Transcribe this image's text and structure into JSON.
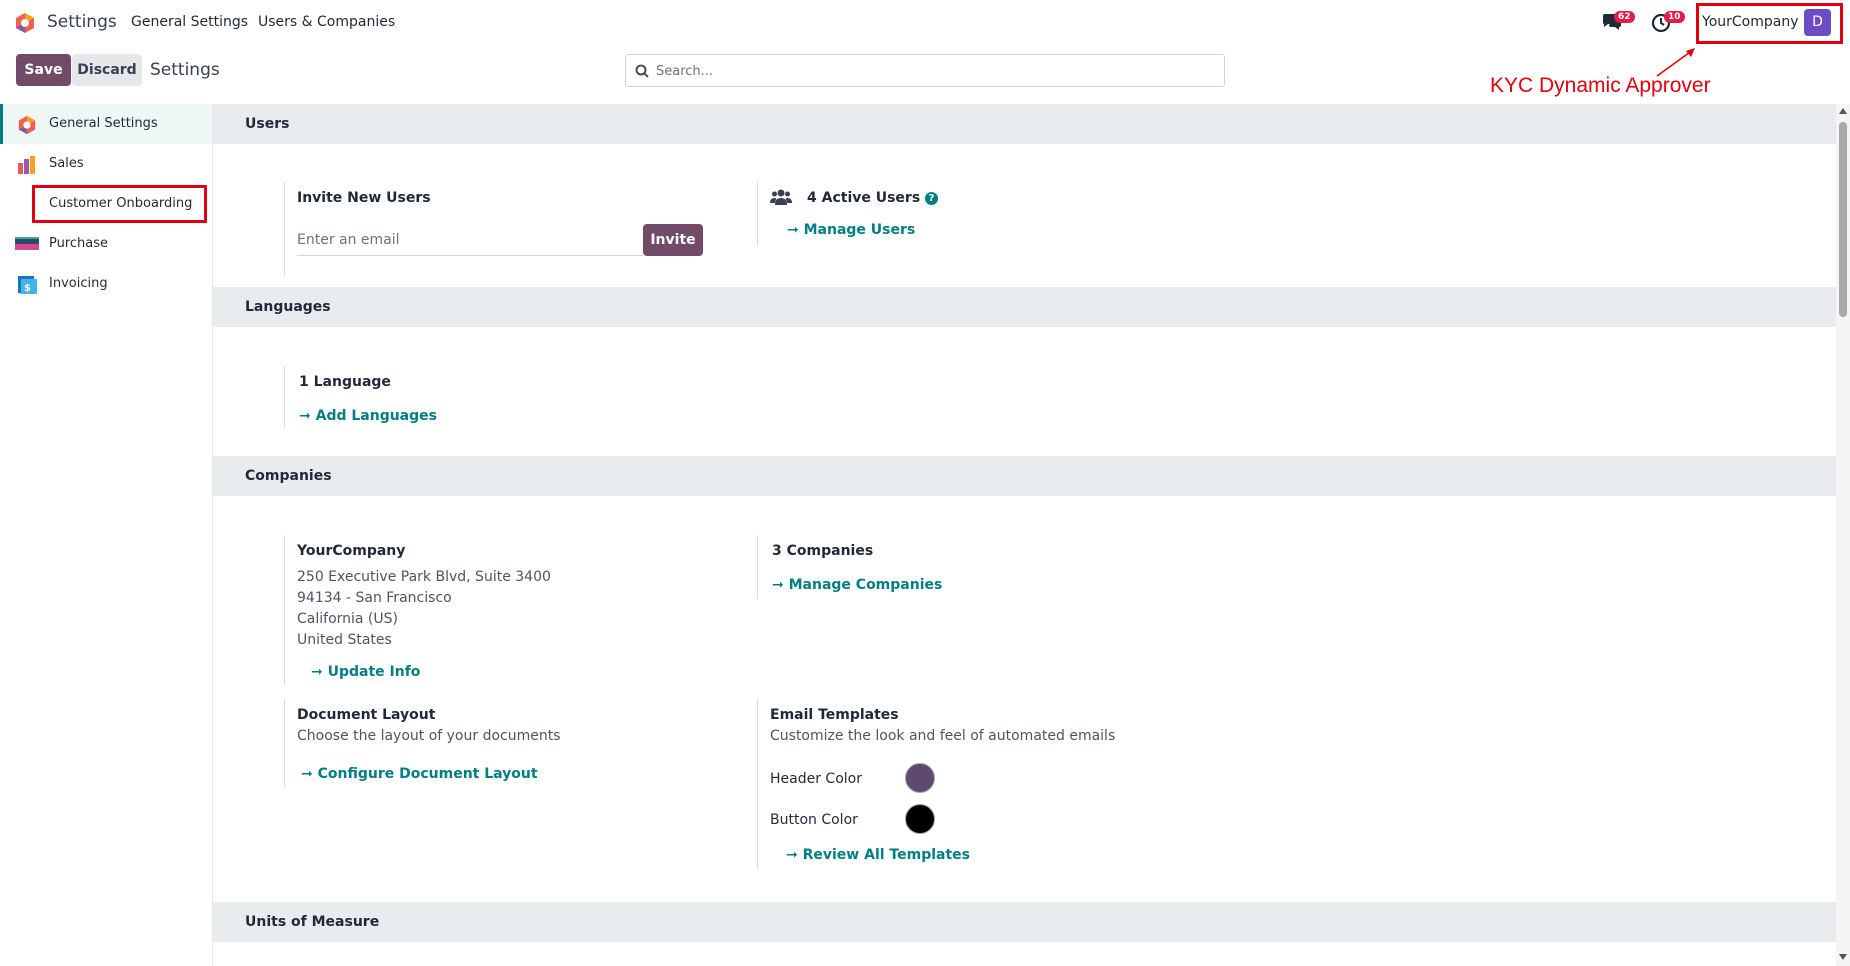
{
  "navbar": {
    "app_title": "Settings",
    "menu": [
      "General Settings",
      "Users & Companies"
    ],
    "chat_badge": "62",
    "activity_badge": "10",
    "company": "YourCompany",
    "avatar_initial": "D"
  },
  "control_panel": {
    "save_label": "Save",
    "discard_label": "Discard",
    "breadcrumb": "Settings",
    "search_placeholder": "Search..."
  },
  "annotation": {
    "text": "KYC Dynamic Approver",
    "color": "#e1000f"
  },
  "sidebar": {
    "items": [
      {
        "label": "General Settings",
        "icon": "settings-app-icon"
      },
      {
        "label": "Sales",
        "icon": "sales-app-icon"
      },
      {
        "label": "Customer Onboarding"
      },
      {
        "label": "Purchase",
        "icon": "purchase-app-icon"
      },
      {
        "label": "Invoicing",
        "icon": "invoicing-app-icon"
      }
    ]
  },
  "sections": {
    "users": {
      "title": "Users",
      "invite_title": "Invite New Users",
      "email_placeholder": "Enter an email",
      "invite_button": "Invite",
      "active_users": "4 Active Users",
      "manage_users": "Manage Users"
    },
    "languages": {
      "title": "Languages",
      "count": "1 Language",
      "add": "Add Languages"
    },
    "companies": {
      "title": "Companies",
      "company_name": "YourCompany",
      "address": [
        "250 Executive Park Blvd, Suite 3400",
        "94134 - San Francisco",
        "California (US)",
        "United States"
      ],
      "update_info": "Update Info",
      "count": "3 Companies",
      "manage": "Manage Companies",
      "doc_layout_title": "Document Layout",
      "doc_layout_desc": "Choose the layout of your documents",
      "doc_layout_link": "Configure Document Layout",
      "email_templates_title": "Email Templates",
      "email_templates_desc": "Customize the look and feel of automated emails",
      "header_color_label": "Header Color",
      "header_color": "#5f4a6f",
      "button_color_label": "Button Color",
      "button_color": "#000000",
      "review_templates": "Review All Templates"
    },
    "uom": {
      "title": "Units of Measure"
    }
  },
  "colors": {
    "brand": "#714b67",
    "link": "#017e84"
  }
}
